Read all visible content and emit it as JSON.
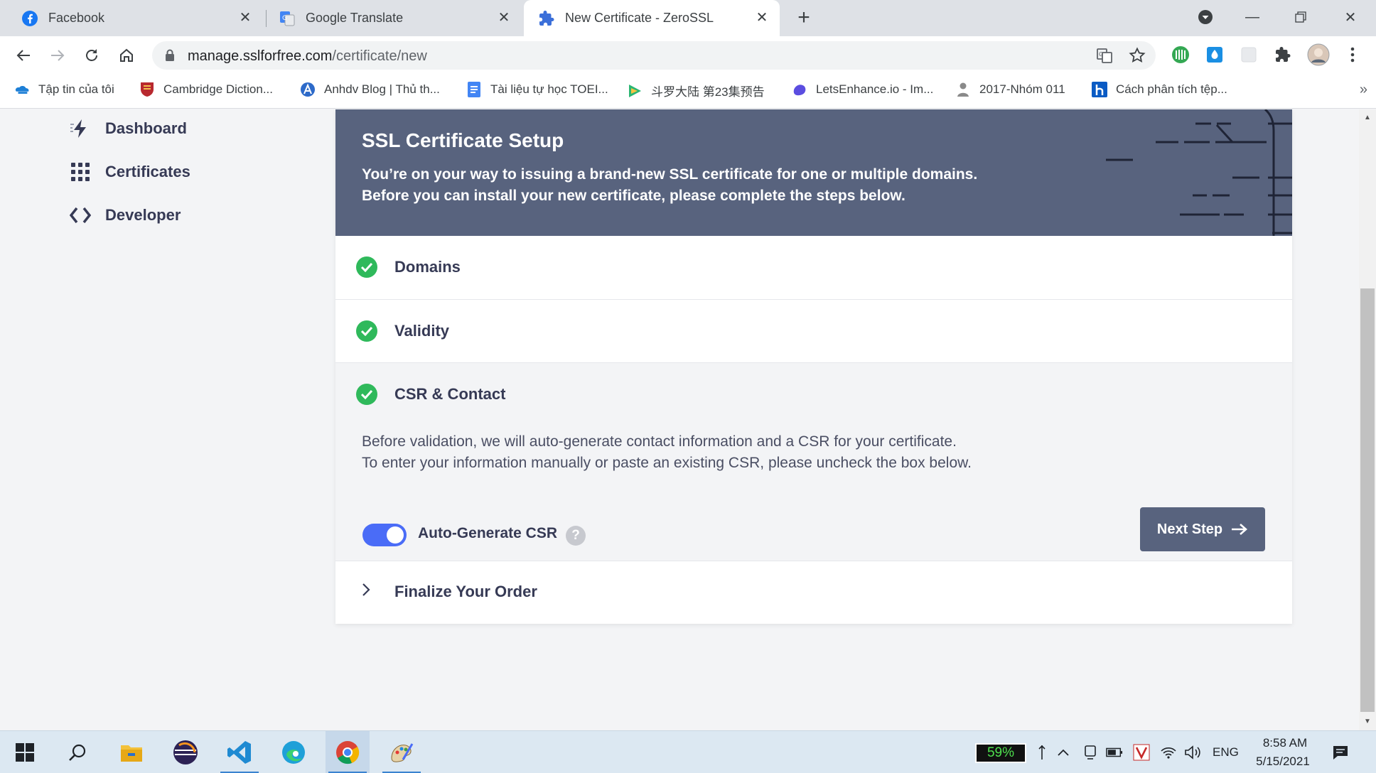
{
  "browser": {
    "tabs": [
      {
        "title": "Facebook",
        "icon": "facebook-icon"
      },
      {
        "title": "Google Translate",
        "icon": "google-translate-icon"
      },
      {
        "title": "New Certificate - ZeroSSL",
        "icon": "puzzle-icon",
        "active": true
      }
    ],
    "url_host": "manage.sslforfree.com",
    "url_path": "/certificate/new",
    "bookmarks": [
      "Tập tin của tôi",
      "Cambridge Diction...",
      "Anhdv Blog | Thủ th...",
      "Tài liệu tự học TOEI...",
      "斗罗大陆 第23集预告",
      "LetsEnhance.io - Im...",
      "2017-Nhóm 011",
      "Cách phân tích tệp..."
    ]
  },
  "sidebar": {
    "items": [
      {
        "label": "Dashboard",
        "icon": "lightning-icon"
      },
      {
        "label": "Certificates",
        "icon": "grid-icon"
      },
      {
        "label": "Developer",
        "icon": "code-icon"
      }
    ]
  },
  "setup": {
    "title": "SSL Certificate Setup",
    "subtitle_line1": "You’re on your way to issuing a brand-new SSL certificate for one or multiple domains.",
    "subtitle_line2": "Before you can install your new certificate, please complete the steps below.",
    "steps": [
      {
        "label": "Domains",
        "status": "complete"
      },
      {
        "label": "Validity",
        "status": "complete"
      },
      {
        "label": "CSR & Contact",
        "status": "complete"
      },
      {
        "label": "Finalize Your Order",
        "status": "collapsed"
      }
    ],
    "csr_text_line1": "Before validation, we will auto-generate contact information and a CSR for your certificate.",
    "csr_text_line2": "To enter your information manually or paste an existing CSR, please uncheck the box below.",
    "toggle_label": "Auto-Generate CSR",
    "toggle_on": true,
    "help_glyph": "?",
    "next_button": "Next Step"
  },
  "taskbar": {
    "battery_percent": "59%",
    "language": "ENG",
    "time": "8:58 AM",
    "date": "5/15/2021"
  },
  "colors": {
    "hero": "#58637e",
    "check": "#2fb95b",
    "toggle": "#4a6cf7",
    "button": "#58637e"
  }
}
